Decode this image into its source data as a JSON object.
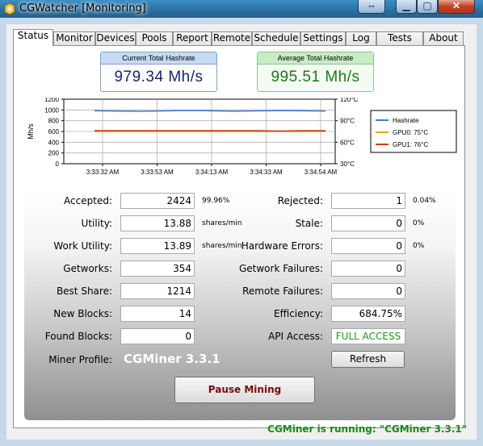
{
  "window": {
    "title": "CGWatcher [Monitoring]"
  },
  "tabs": [
    "Status",
    "Monitor",
    "Devices",
    "Pools",
    "Report",
    "Remote",
    "Schedule",
    "Settings",
    "Log",
    "Tests",
    "About"
  ],
  "hashrate": {
    "current_label": "Current Total Hashrate",
    "current_value": "979.34 Mh/s",
    "average_label": "Average Total Hashrate",
    "average_value": "995.51 Mh/s"
  },
  "chart_data": {
    "type": "line",
    "ylabel": "Mh/s",
    "y_ticks": [
      "1200",
      "1000",
      "800",
      "600",
      "400",
      "200",
      "0"
    ],
    "ylim": [
      0,
      1200
    ],
    "y2_ticks": [
      "120°C",
      "90°C",
      "60°C",
      "30°C"
    ],
    "y2lim": [
      30,
      120
    ],
    "x_ticks": [
      "3:33:32 AM",
      "3:33:53 AM",
      "3:34:13 AM",
      "3:34:33 AM",
      "3:34:54 AM"
    ],
    "grid": true,
    "legend_position": "right",
    "series": [
      {
        "name": "Hashrate",
        "color": "#3f7fd6",
        "axis": "left",
        "values": [
          985,
          980,
          975,
          982,
          990,
          985,
          978,
          983,
          987,
          985,
          979
        ]
      },
      {
        "name": "GPU0: 75°C",
        "color": "#f0a020",
        "axis": "right",
        "values": [
          75,
          75,
          75,
          75,
          75,
          75,
          75,
          75,
          75,
          75,
          75
        ]
      },
      {
        "name": "GPU1: 76°C",
        "color": "#d03c10",
        "axis": "right",
        "values": [
          76,
          76,
          76,
          76,
          76,
          76,
          76,
          76,
          75.5,
          76,
          76
        ]
      }
    ]
  },
  "stats": {
    "accepted": {
      "label": "Accepted:",
      "value": "2424",
      "extra": "99.96%"
    },
    "utility": {
      "label": "Utility:",
      "value": "13.88",
      "extra": "shares/min"
    },
    "work_utility": {
      "label": "Work Utility:",
      "value": "13.89",
      "extra": "shares/min"
    },
    "getworks": {
      "label": "Getworks:",
      "value": "354"
    },
    "best_share": {
      "label": "Best Share:",
      "value": "1214"
    },
    "new_blocks": {
      "label": "New Blocks:",
      "value": "14"
    },
    "found_blocks": {
      "label": "Found Blocks:",
      "value": "0"
    },
    "miner_profile": {
      "label": "Miner Profile:",
      "value": "CGMiner 3.3.1"
    },
    "rejected": {
      "label": "Rejected:",
      "value": "1",
      "extra": "0.04%"
    },
    "stale": {
      "label": "Stale:",
      "value": "0",
      "extra": "0%"
    },
    "hardware_errors": {
      "label": "Hardware Errors:",
      "value": "0",
      "extra": "0%"
    },
    "getwork_failures": {
      "label": "Getwork Failures:",
      "value": "0"
    },
    "remote_failures": {
      "label": "Remote Failures:",
      "value": "0"
    },
    "efficiency": {
      "label": "Efficiency:",
      "value": "684.75%"
    },
    "api_access": {
      "label": "API Access:",
      "value": "FULL ACCESS"
    }
  },
  "buttons": {
    "refresh": "Refresh",
    "pause": "Pause Mining"
  },
  "status_text": "CGMiner is running: \"CGMiner 3.3.1\""
}
